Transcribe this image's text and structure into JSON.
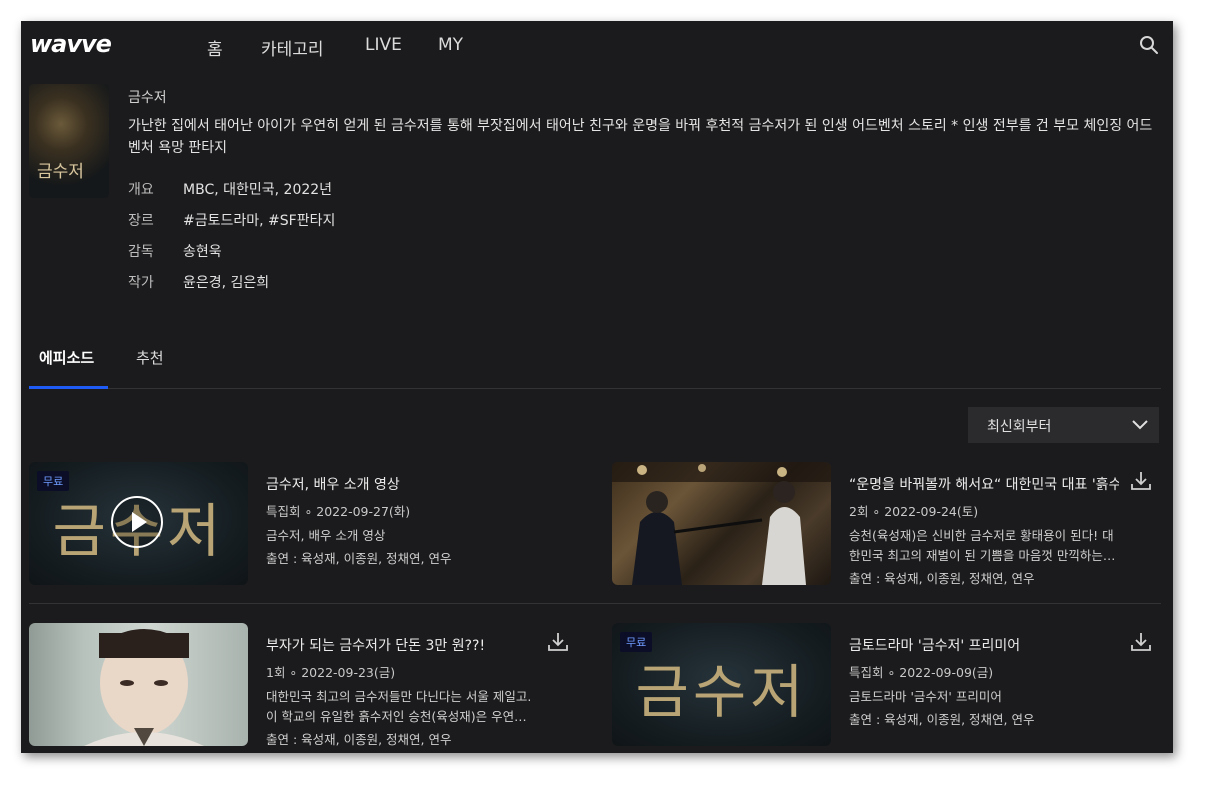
{
  "nav": {
    "logo": "wavve",
    "items": [
      "홈",
      "카테고리",
      "LIVE",
      "MY"
    ]
  },
  "program": {
    "poster_text": "금수저",
    "title": "금수저",
    "description": "가난한 집에서 태어난 아이가 우연히 얻게 된 금수저를 통해 부잣집에서 태어난 친구와 운명을 바꿔 후천적 금수저가 된 인생 어드벤처 스토리 * 인생 전부를 건 부모 체인징 어드벤처 욕망 판타지",
    "meta": [
      {
        "key": "개요",
        "value": "MBC, 대한민국, 2022년"
      },
      {
        "key": "장르",
        "value": "#금토드라마, #SF판타지"
      },
      {
        "key": "감독",
        "value": "송현욱"
      },
      {
        "key": "작가",
        "value": "윤은경, 김은희"
      }
    ]
  },
  "tabs": [
    "에피소드",
    "추천"
  ],
  "sort": {
    "label": "최신회부터"
  },
  "episodes": [
    {
      "badge": "무료",
      "thumb_text": "금수저",
      "title": "금수저, 배우 소개 영상",
      "meta": "특집회 ∘ 2022-09-27(화)",
      "desc": "금수저, 배우 소개 영상",
      "cast": "출연 : 육성재, 이종원, 정채연, 연우"
    },
    {
      "badge": "",
      "thumb_text": "",
      "title": "“운명을 바꿔볼까 해서요“ 대한민국 대표 '흙수저' 육성재의 인생을 바꿀 금수저",
      "meta": "2회 ∘ 2022-09-24(토)",
      "desc": "승천(육성재)은 신비한 금수저로 황태용이 된다! 대한민국 최고의 재벌이 된 기쁨을 마음껏 만끽하는…",
      "cast": "출연 : 육성재, 이종원, 정채연, 연우"
    },
    {
      "badge": "",
      "thumb_text": "",
      "title": "부자가 되는 금수저가 단돈 3만 원??!",
      "meta": "1회 ∘ 2022-09-23(금)",
      "desc": "대한민국 최고의 금수저들만 다닌다는 서울 제일고. 이 학교의 유일한 흙수저인 승천(육성재)은 우연…",
      "cast": "출연 : 육성재, 이종원, 정채연, 연우"
    },
    {
      "badge": "무료",
      "thumb_text": "금수저",
      "title": "금토드라마 '금수저' 프리미어",
      "meta": "특집회 ∘ 2022-09-09(금)",
      "desc": "금토드라마 '금수저' 프리미어",
      "cast": "출연 : 육성재, 이종원, 정채연, 연우"
    }
  ]
}
